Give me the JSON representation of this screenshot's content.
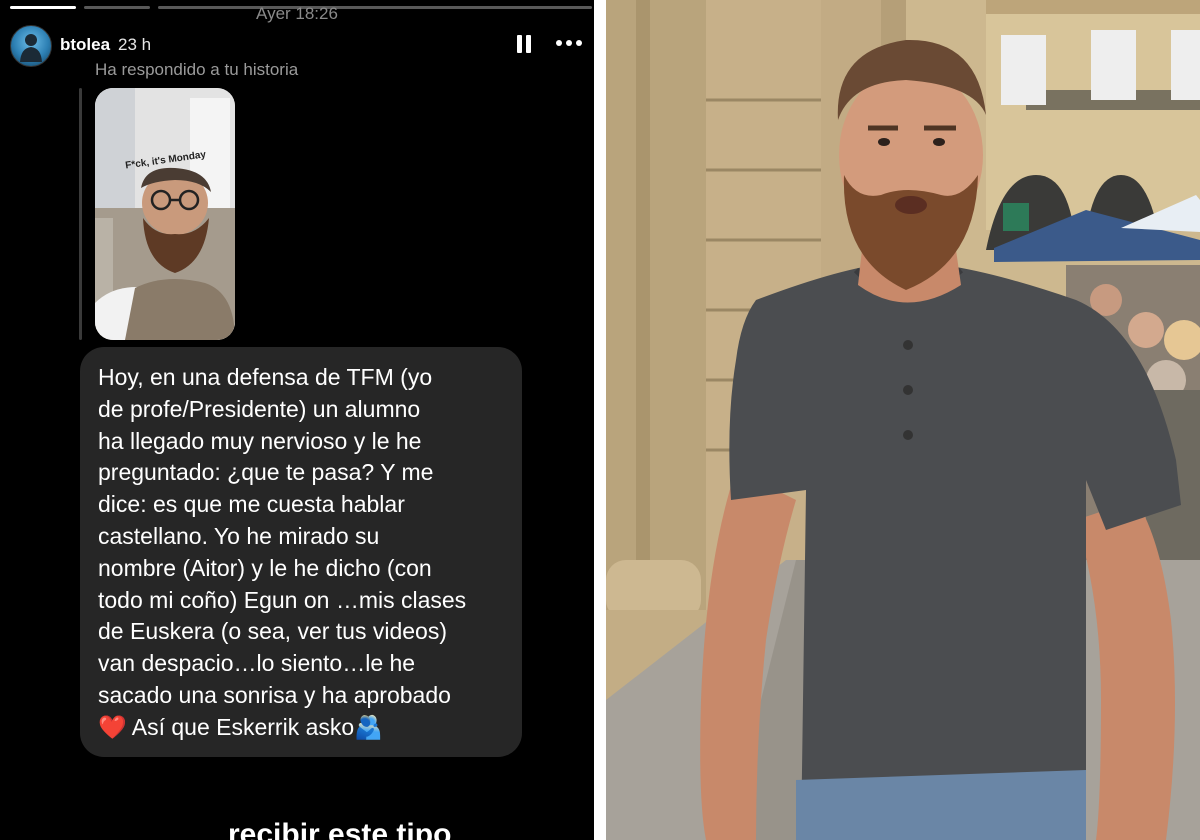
{
  "story": {
    "timestamp": "Ayer 18:26",
    "username": "btolea",
    "time_ago": "23 h",
    "reply_note": "Ha respondido a tu historia",
    "thumbnail_caption": "F*ck, it's Monday",
    "progress_segments": [
      1,
      0,
      0
    ],
    "message": "Hoy, en una defensa de TFM (yo\nde profe/Presidente) un alumno\nha llegado muy nervioso y le he\npreguntado: ¿que te pasa? Y me\ndice: es que me cuesta hablar\ncastellano. Yo he mirado su\nnombre (Aitor) y le he dicho (con\ntodo mi coño) Egun on …mis clases\nde Euskera (o sea, ver tus videos)\nvan despacio…lo siento…le he\nsacado una sonrisa y ha aprobado\n❤️ Así que Eskerrik asko🫂",
    "cutoff_text": "recibir este tipo",
    "icons": {
      "pause": "pause-icon",
      "more": "more-options-icon"
    },
    "colors": {
      "background": "#000000",
      "bubble": "#262626",
      "meta_text": "#9a9a9a"
    }
  },
  "photo": {
    "description_icon": "photo-bearded-man-street",
    "colors": {
      "shirt": "#4a4c4e",
      "stone": "#c9b58e",
      "awning": "#3b5a8a"
    }
  }
}
